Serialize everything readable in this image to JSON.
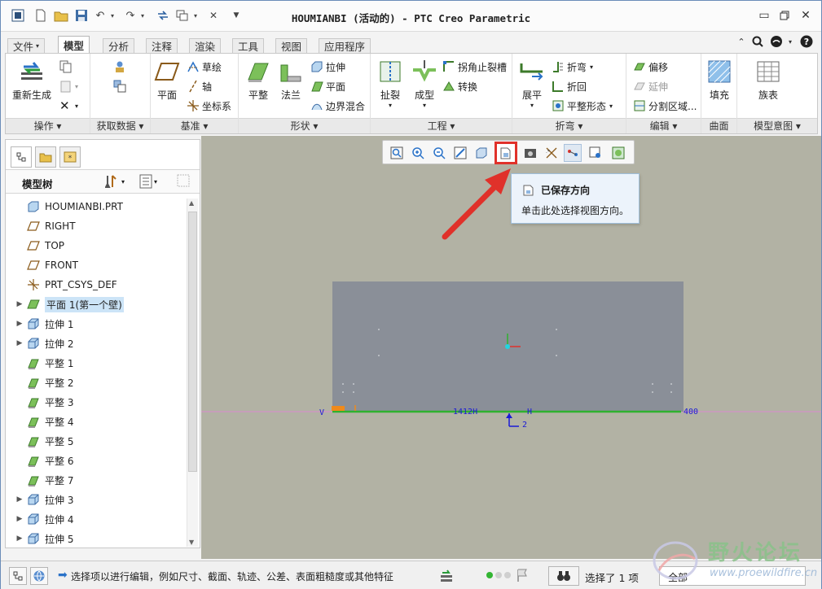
{
  "window": {
    "title": "HOUMIANBI (活动的) - PTC Creo Parametric"
  },
  "menu_tabs": [
    "文件",
    "模型",
    "分析",
    "注释",
    "渲染",
    "工具",
    "视图",
    "应用程序"
  ],
  "ribbon": {
    "groups": {
      "operations": "操作",
      "get_data": "获取数据",
      "datum": "基准",
      "shapes": "形状",
      "engineering": "工程",
      "bends": "折弯",
      "editing": "编辑",
      "surfaces": "曲面",
      "model_intent": "模型意图"
    },
    "regenerate": "重新生成",
    "plane": "平面",
    "sketch": "草绘",
    "axis": "轴",
    "csys": "坐标系",
    "planar": "平整",
    "flange": "法兰",
    "extrude": "拉伸",
    "flat": "平面",
    "boundary_blend": "边界混合",
    "rip": "扯裂",
    "form": "成型",
    "corner_relief": "拐角止裂槽",
    "convert": "转换",
    "unbend": "展平",
    "bend": "折弯",
    "bend_back": "折回",
    "flat_pattern": "平整形态",
    "offset": "偏移",
    "extend": "延伸",
    "split_area": "分割区域...",
    "fill": "填充",
    "family_table": "族表"
  },
  "model_tree": {
    "title": "模型树",
    "items": [
      {
        "label": "HOUMIANBI.PRT",
        "icon": "part-icon",
        "expand": false
      },
      {
        "label": "RIGHT",
        "icon": "datum-plane-icon",
        "expand": false
      },
      {
        "label": "TOP",
        "icon": "datum-plane-icon",
        "expand": false
      },
      {
        "label": "FRONT",
        "icon": "datum-plane-icon",
        "expand": false
      },
      {
        "label": "PRT_CSYS_DEF",
        "icon": "csys-icon",
        "expand": false
      },
      {
        "label": "平面 1(第一个壁)",
        "icon": "planar-wall-icon",
        "expand": true,
        "selected": true
      },
      {
        "label": "拉伸 1",
        "icon": "extrude-icon",
        "expand": true
      },
      {
        "label": "拉伸 2",
        "icon": "extrude-icon",
        "expand": true
      },
      {
        "label": "平整 1",
        "icon": "flat-wall-icon",
        "expand": false
      },
      {
        "label": "平整 2",
        "icon": "flat-wall-icon",
        "expand": false
      },
      {
        "label": "平整 3",
        "icon": "flat-wall-icon",
        "expand": false
      },
      {
        "label": "平整 4",
        "icon": "flat-wall-icon",
        "expand": false
      },
      {
        "label": "平整 5",
        "icon": "flat-wall-icon",
        "expand": false
      },
      {
        "label": "平整 6",
        "icon": "flat-wall-icon",
        "expand": false
      },
      {
        "label": "平整 7",
        "icon": "flat-wall-icon",
        "expand": false
      },
      {
        "label": "拉伸 3",
        "icon": "extrude-icon",
        "expand": true
      },
      {
        "label": "拉伸 4",
        "icon": "extrude-icon",
        "expand": true
      },
      {
        "label": "拉伸 5",
        "icon": "extrude-icon",
        "expand": true
      }
    ]
  },
  "tooltip": {
    "title": "已保存方向",
    "body": "单击此处选择视图方向。"
  },
  "canvas_labels": {
    "left": "V",
    "center_dim": "1412H",
    "h_mark": "H",
    "two": "2",
    "right_dim": "400"
  },
  "status": {
    "message": "选择项以进行编辑，例如尺寸、截面、轨迹、公差、表面粗糙度或其他特征",
    "selection": "选择了 1 项",
    "filter": "全部"
  },
  "watermark": {
    "cn": "野火论坛",
    "url": "www.proewildfire.cn"
  },
  "colors": {
    "highlight_red": "#e0312a",
    "graphics_bg": "#b2b2a4",
    "part_gray": "#8a8f98",
    "edge_green": "#2fb12f",
    "dim_blue": "#1a1ad6"
  }
}
